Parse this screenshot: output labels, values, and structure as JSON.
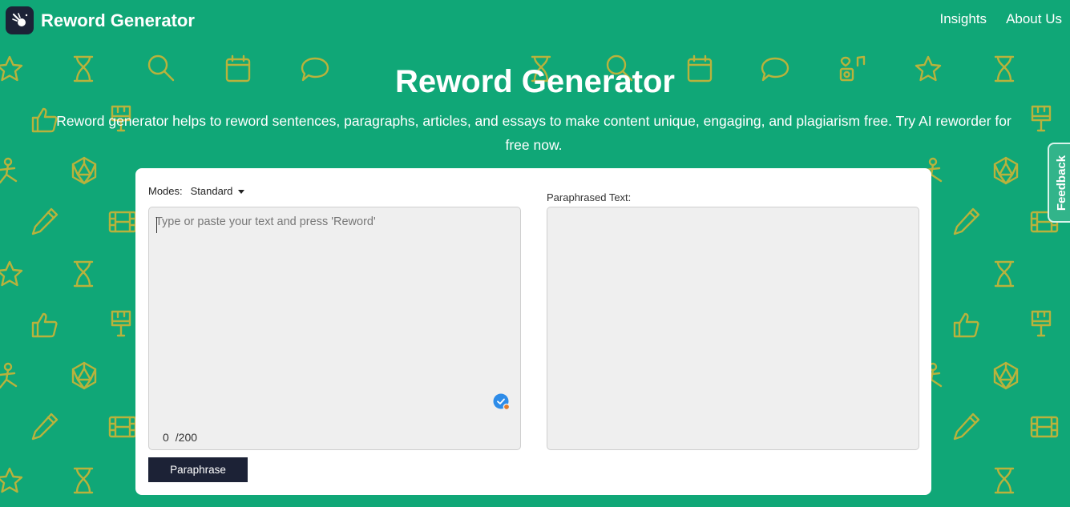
{
  "header": {
    "brand": "Reword Generator",
    "nav": [
      "Insights",
      "About Us"
    ]
  },
  "hero": {
    "title": "Reword Generator",
    "subtitle": "Reword generator helps to reword sentences, paragraphs, articles, and essays to make content unique, engaging, and plagiarism free. Try AI reworder for free now."
  },
  "feedback": {
    "label": "Feedback"
  },
  "tool": {
    "modes_label": "Modes:",
    "mode_value": "Standard",
    "input_placeholder": "Type or paste your text and press 'Reword'",
    "input_value": "",
    "word_count": "0",
    "word_limit": "/200",
    "output_label": "Paraphrased Text:",
    "paraphrase_button": "Paraphrase"
  },
  "colors": {
    "background": "#10a777",
    "pattern": "#b9b23c",
    "dark": "#1c2236",
    "card": "#ffffff"
  }
}
